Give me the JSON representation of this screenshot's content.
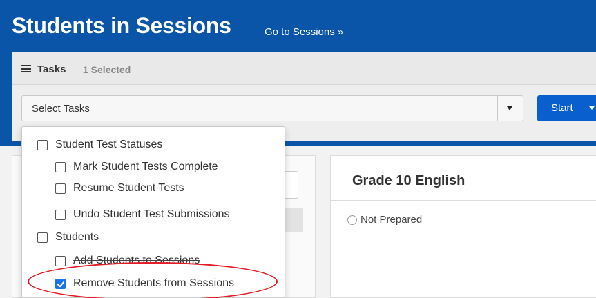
{
  "header": {
    "title": "Students in Sessions",
    "goto_link": "Go to Sessions »"
  },
  "tasks": {
    "label": "Tasks",
    "selected_count": "1 Selected",
    "select_placeholder": "Select Tasks",
    "start_label": "Start"
  },
  "dropdown": {
    "options": [
      {
        "label": "Student Test Statuses",
        "checked": false
      },
      {
        "label": "Mark Student Tests Complete",
        "checked": false
      },
      {
        "label": "Resume Student Tests",
        "checked": false
      },
      {
        "label": "Undo Student Test Submissions",
        "checked": false
      },
      {
        "label": "Students",
        "checked": false
      },
      {
        "label": "Add Students to Sessions",
        "checked": false
      },
      {
        "label": "Remove Students from Sessions",
        "checked": true
      }
    ]
  },
  "session_card": {
    "title": "Grade 10 English",
    "status": "Not Prepared"
  },
  "colors": {
    "header_blue": "#0a55a8",
    "start_button_blue": "#0a5fcf",
    "checkbox_checked": "#1a73e8",
    "highlight_red": "#e31b23"
  }
}
